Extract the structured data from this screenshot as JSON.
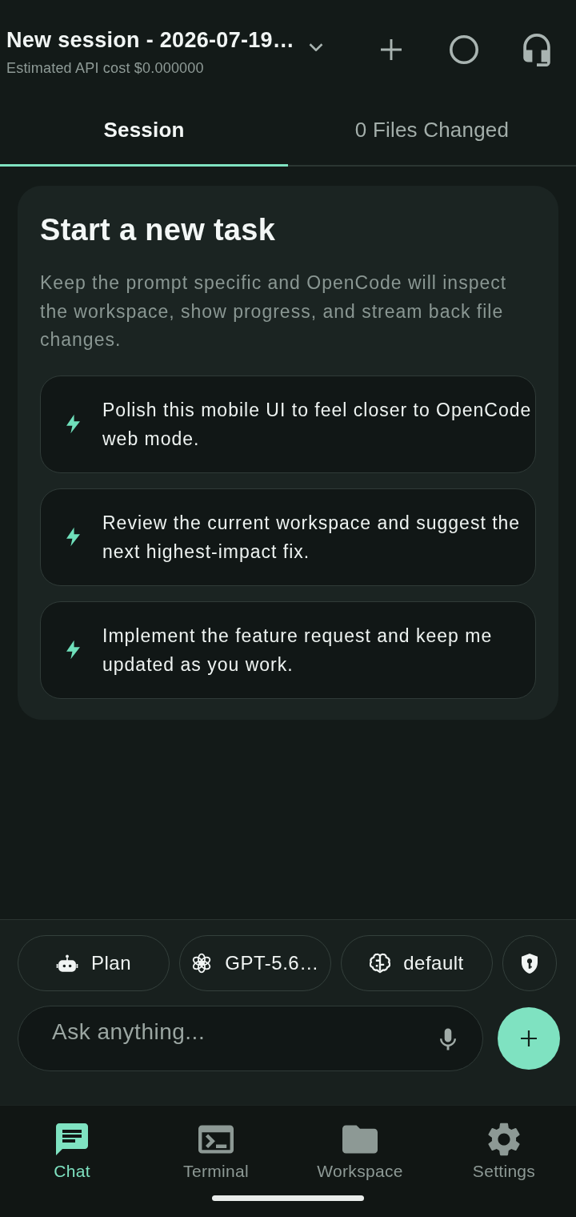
{
  "header": {
    "title": "New session - 2026-07-19…",
    "subtitle": "Estimated API cost $0.000000"
  },
  "tabs": [
    {
      "label": "Session",
      "selected": true
    },
    {
      "label": "0 Files Changed",
      "selected": false
    }
  ],
  "intro": {
    "title": "Start a new task",
    "text": "Keep the prompt specific and OpenCode will inspect the workspace, show progress, and stream back file changes."
  },
  "suggestions": [
    {
      "text": "Polish this mobile UI to feel closer to OpenCode web mode."
    },
    {
      "text": "Review the current workspace and suggest the next highest-impact fix."
    },
    {
      "text": "Implement the feature request and keep me updated as you work."
    }
  ],
  "chips": [
    {
      "kind": "agent",
      "label": "Plan"
    },
    {
      "kind": "model",
      "label": "GPT-5.6…"
    },
    {
      "kind": "reasoning",
      "label": "default"
    },
    {
      "kind": "permission"
    }
  ],
  "composer": {
    "placeholder": "Ask anything..."
  },
  "nav": [
    {
      "kind": "chat",
      "label": "Chat",
      "selected": true
    },
    {
      "kind": "terminal",
      "label": "Terminal",
      "selected": false
    },
    {
      "kind": "workspace",
      "label": "Workspace",
      "selected": false
    },
    {
      "kind": "settings",
      "label": "Settings",
      "selected": false
    }
  ]
}
